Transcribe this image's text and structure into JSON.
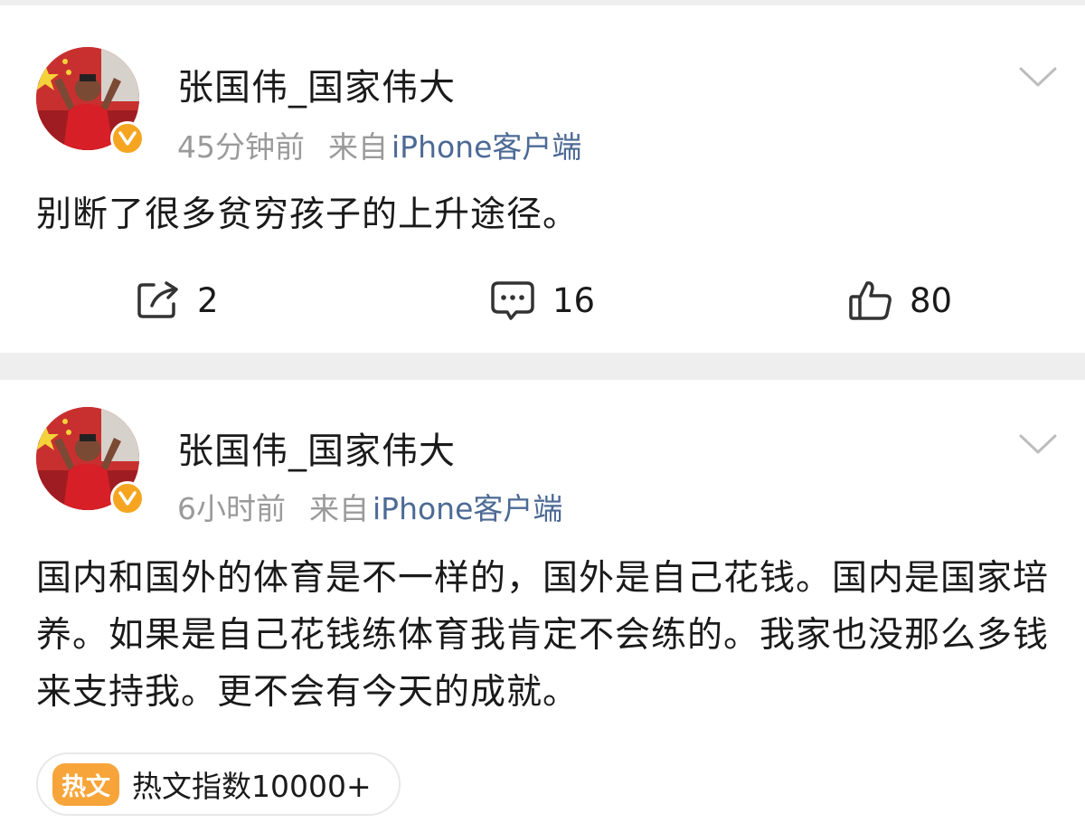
{
  "posts": [
    {
      "username": "张国伟_国家伟大",
      "time": "45分钟前",
      "from_label": "来自",
      "client": "iPhone客户端",
      "text": "别断了很多贫穷孩子的上升途径。",
      "actions": {
        "repost_count": "2",
        "comment_count": "16",
        "like_count": "80"
      }
    },
    {
      "username": "张国伟_国家伟大",
      "time": "6小时前",
      "from_label": "来自",
      "client": "iPhone客户端",
      "text": "国内和国外的体育是不一样的，国外是自己花钱。国内是国家培养。如果是自己花钱练体育我肯定不会练的。我家也没那么多钱来支持我。更不会有今天的成就。",
      "hot_tag": {
        "badge": "热文",
        "text": "热文指数10000+"
      }
    }
  ],
  "icons": {
    "verified": "verified-v-icon",
    "menu": "chevron-down-icon",
    "repost": "repost-icon",
    "comment": "comment-icon",
    "like": "thumbs-up-icon"
  },
  "colors": {
    "text": "#1a1a1a",
    "meta": "#9a9a9a",
    "client_link": "#4d6a95",
    "verified_badge": "#f6a521",
    "hot_badge": "#f7a53a",
    "separator": "#eeeeee"
  }
}
